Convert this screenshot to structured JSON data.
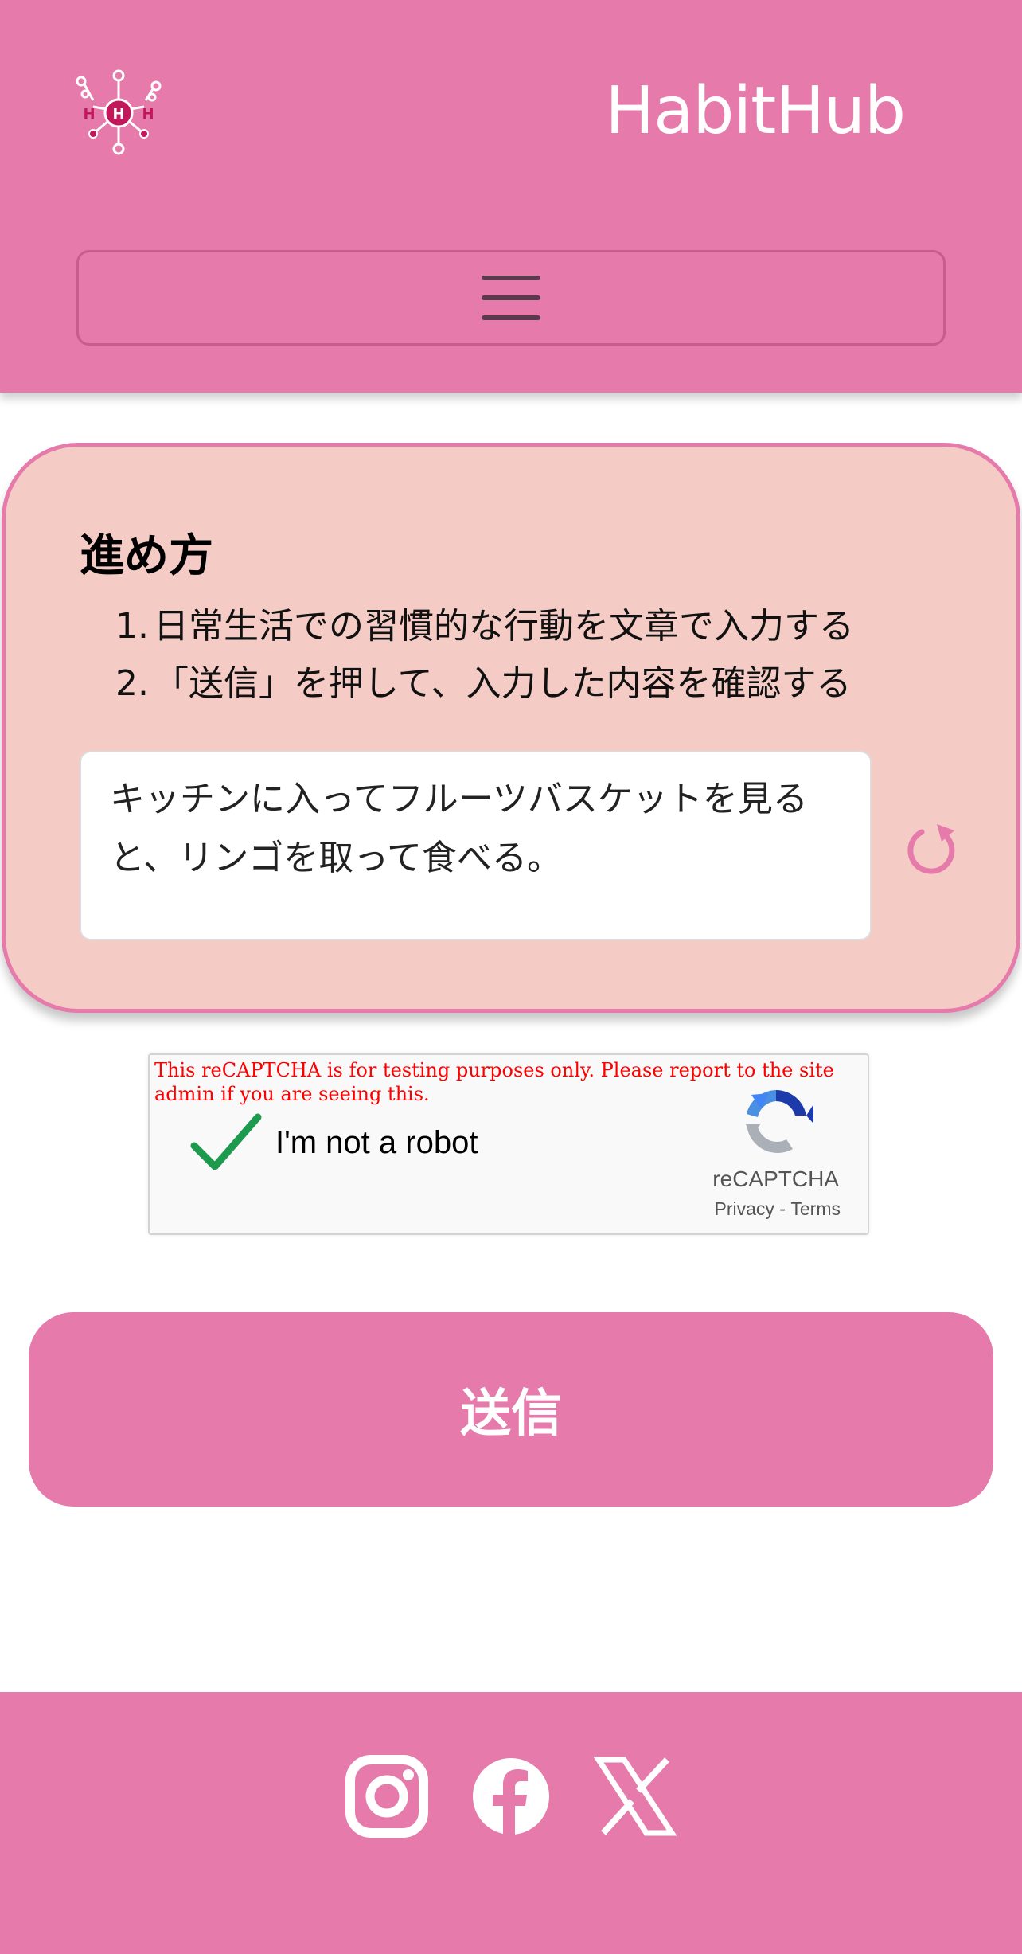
{
  "header": {
    "brand": "HabitHub",
    "logo_letters": [
      "H",
      "H",
      "H"
    ],
    "menu_icon": "hamburger-menu-icon",
    "background_color": "#e57aab"
  },
  "instructions": {
    "title": "進め方",
    "steps": [
      {
        "num": "1.",
        "text": "日常生活での習慣的な行動を文章で入力する"
      },
      {
        "num": "2.",
        "text": "「送信」を押して、入力した内容を確認する"
      }
    ],
    "card_color": "#f4ccc5",
    "input_value": "キッチンに入ってフルーツバスケットを見ると、リンゴを取って食べる。",
    "reset_icon": "reset-rotate-icon"
  },
  "recaptcha": {
    "warning": "This reCAPTCHA is for testing purposes only. Please report to the site admin if you are seeing this.",
    "label": "I'm not a robot",
    "checked": true,
    "brand": "reCAPTCHA",
    "privacy": "Privacy",
    "separator": " - ",
    "terms": "Terms"
  },
  "submit": {
    "label": "送信"
  },
  "footer": {
    "social": [
      {
        "name": "instagram-icon"
      },
      {
        "name": "facebook-icon"
      },
      {
        "name": "x-icon"
      }
    ]
  }
}
